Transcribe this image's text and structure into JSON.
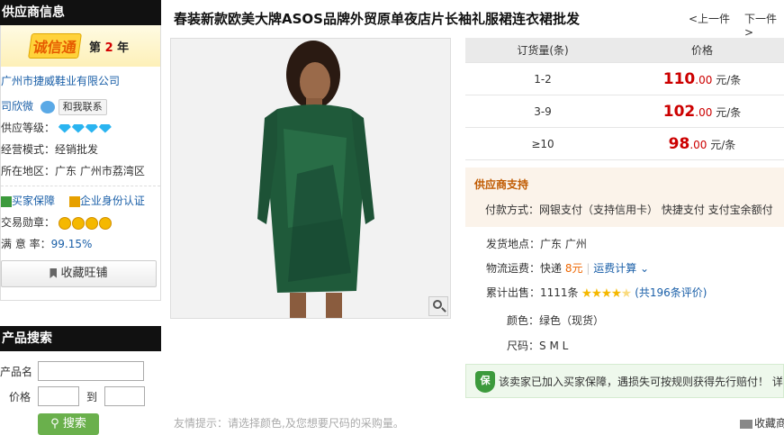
{
  "supplier": {
    "header": "供应商信息",
    "badge_logo": "诚信通",
    "badge_years_label": "第",
    "badge_years": "2",
    "badge_years_unit": "年",
    "company": "广州市捷威鞋业有限公司",
    "contact_name": "司欣微",
    "contact_button": "和我联系",
    "level_label": "供应等级：",
    "model_label": "经营模式：",
    "model_value": "经销批发",
    "location_label": "所在地区：",
    "location_value": "广东 广州市荔湾区",
    "protect_label": "买家保障",
    "verify_label": "企业身份认证",
    "medal_label": "交易勋章：",
    "satisfaction_label": "满 意 率：",
    "satisfaction_value": "99.15%",
    "favorite_button": "收藏旺铺"
  },
  "search": {
    "header": "产品搜索",
    "name_label": "产品名",
    "price_label": "价格",
    "to_label": "到",
    "button": "搜索"
  },
  "product": {
    "title": "春装新款欧美大牌ASOS品牌外贸原单夜店片长袖礼服裙连衣裙批发",
    "prev": "<上一件",
    "next": "下一件>",
    "hint": "友情提示：请选择颜色,及您想要尺码的采购量。"
  },
  "price_table": {
    "col_qty": "订货量(条)",
    "col_price": "价格",
    "rows": [
      {
        "qty": "1-2",
        "price": "110",
        "dec": ".00",
        "unit": "元/条"
      },
      {
        "qty": "3-9",
        "price": "102",
        "dec": ".00",
        "unit": "元/条"
      },
      {
        "qty": "≥10",
        "price": "98",
        "dec": ".00",
        "unit": "元/条"
      }
    ]
  },
  "support": {
    "title": "供应商支持",
    "pay_label": "付款方式：",
    "pay_value": "网银支付（支持信用卡）  快捷支付  支付宝余额付"
  },
  "details": {
    "ship_label": "发货地点：",
    "ship_value": "广东 广州",
    "freight_label": "物流运费：",
    "freight_prefix": "快递",
    "freight_amount": "8元",
    "freight_link": "运费计算",
    "sold_label": "累计出售：",
    "sold_value": "1111条",
    "review_link": "(共196条评价)",
    "color_label": "颜色：",
    "color_value": "绿色（现货）",
    "size_label": "尺码：",
    "size_value": "S  M  L"
  },
  "guarantee": {
    "shield": "保",
    "text": "该卖家已加入买家保障，遇损失可按规则获得先行赔付！ 详"
  },
  "footer": {
    "collect": "收藏商"
  },
  "colors": {
    "price": "#cc0000",
    "link": "#1a5fa8",
    "supplier_title": "#c05a00",
    "search_button": "#6ab04c"
  }
}
